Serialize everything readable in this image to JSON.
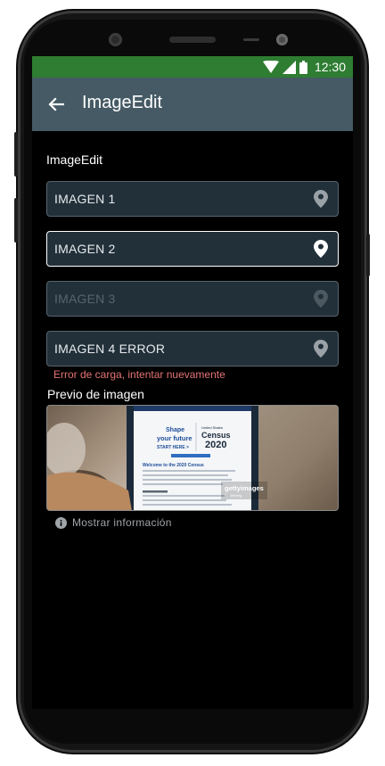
{
  "status_bar": {
    "time": "12:30",
    "color": "#2e7d32"
  },
  "app_bar": {
    "title": "ImageEdit",
    "back_icon": "arrow-left-icon",
    "color": "#455a64"
  },
  "form": {
    "section_title": "ImageEdit",
    "fields": [
      {
        "label": "IMAGEN 1",
        "icon": "location-pin-icon",
        "state": "normal"
      },
      {
        "label": "IMAGEN 2",
        "icon": "location-pin-icon",
        "state": "focused"
      },
      {
        "label": "IMAGEN 3",
        "icon": "location-pin-icon",
        "state": "disabled"
      },
      {
        "label": "IMAGEN 4 ERROR",
        "icon": "location-pin-icon",
        "state": "error"
      }
    ],
    "error_message": "Error de carga, intentar nuevamente"
  },
  "preview": {
    "label": "Previo de imagen",
    "image": {
      "card_line1": "Shape",
      "card_line2": "your future",
      "card_line3": "START HERE >",
      "census_top": "United States",
      "census_word": "Census",
      "census_year": "2020",
      "welcome": "Welcome to the 2020 Census",
      "watermark": "gettyimages",
      "watermark_sub": "Bloomberg"
    }
  },
  "info": {
    "icon": "info-icon",
    "text": "Mostrar información"
  }
}
